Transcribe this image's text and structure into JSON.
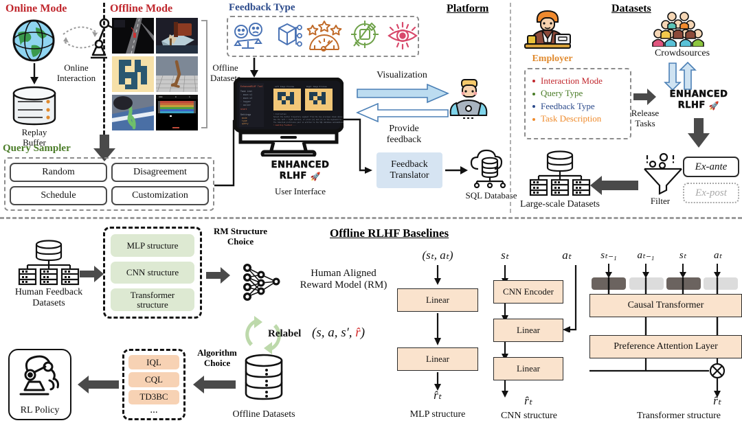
{
  "sections": {
    "online_mode": "Online Mode",
    "offline_mode": "Offline Mode",
    "feedback_type": "Feedback Type",
    "platform": "Platform",
    "datasets": "Datasets",
    "query_sampler": "Query Sampler",
    "offline_rlhf_baselines": "Offline RLHF Baselines"
  },
  "online": {
    "globe_icon": "globe-icon",
    "robot_icon": "robot-arm-icon",
    "interaction_label_line1": "Online",
    "interaction_label_line2": "Interaction",
    "buffer_icon": "database-icon",
    "buffer_label_line1": "Replay",
    "buffer_label_line2": "Buffer"
  },
  "offline": {
    "datasets_label_line1": "Offline",
    "datasets_label_line2": "Datasets",
    "thumbnails": [
      {
        "name": "driving-sim-thumbnail"
      },
      {
        "name": "robot-manipulation-thumbnail"
      },
      {
        "name": "maze-thumbnail"
      },
      {
        "name": "hopper-thumbnail"
      },
      {
        "name": "walker-thumbnail"
      },
      {
        "name": "atari-breakout-thumbnail"
      }
    ]
  },
  "query_sampler": {
    "options": [
      "Random",
      "Disagreement",
      "Schedule",
      "Customization"
    ]
  },
  "feedback_icons": [
    {
      "name": "comparative-feedback-icon",
      "color": "#4a73b5"
    },
    {
      "name": "attribute-feedback-icon",
      "color": "#4a73b5"
    },
    {
      "name": "evaluative-feedback-icon",
      "color": "#c06a28"
    },
    {
      "name": "keypoint-feedback-icon",
      "color": "#6fa24a"
    },
    {
      "name": "visual-feedback-icon",
      "color": "#d8496b"
    }
  ],
  "platform": {
    "ui_logo_line1": "ENHANCED",
    "ui_logo_line2": "RLHF",
    "ui_caption": "User Interface",
    "visualization_label": "Visualization",
    "provide_feedback_line1": "Provide",
    "provide_feedback_line2": "feedback",
    "human_icon": "human-annotator-icon",
    "translator_line1": "Feedback",
    "translator_line2": "Translator",
    "sql_icon": "cloud-database-icon",
    "sql_label": "SQL Database"
  },
  "datasets": {
    "employer_label": "Employer",
    "employer_icon": "employer-icon",
    "employer_items": [
      {
        "label": "Interaction Mode",
        "color": "#c1272d"
      },
      {
        "label": "Query Type",
        "color": "#4a7c27"
      },
      {
        "label": "Feedback Type",
        "color": "#2b4a8b"
      },
      {
        "label": "Task Description",
        "color": "#ef8b2c"
      }
    ],
    "crowdsources_label": "Crowdsources",
    "crowdsources_icon": "crowd-icon",
    "release_tasks_line1": "Release",
    "release_tasks_line2": "Tasks",
    "platform_logo_line1": "ENHANCED",
    "platform_logo_line2": "RLHF",
    "filter_label": "Filter",
    "filter_icon": "funnel-icon",
    "ex_ante": "Ex-ante",
    "ex_post": "Ex-post",
    "large_scale_label": "Large-scale Datasets",
    "large_scale_icon": "server-stack-icon"
  },
  "bottom": {
    "human_feedback_line1": "Human Feedback",
    "human_feedback_line2": "Datasets",
    "human_feedback_icon": "server-stack-icon",
    "rm_structures": [
      "MLP structure",
      "CNN structure",
      "Transformer structure"
    ],
    "rm_structure_choice_line1": "RM Structure",
    "rm_structure_choice_line2": "Choice",
    "nn_icon": "neural-network-icon",
    "reward_model_line1": "Human Aligned",
    "reward_model_line2": "Reward Model (RM)",
    "relabel_label": "Relabel",
    "relabel_tuple_prefix": "(s, a, s′, ",
    "relabel_tuple_r": "r̂",
    "relabel_tuple_suffix": ")",
    "offline_datasets_label": "Offline Datasets",
    "offline_datasets_icon": "database-icon",
    "algorithm_choice_line1": "Algorithm",
    "algorithm_choice_line2": "Choice",
    "algorithms": [
      "IQL",
      "CQL",
      "TD3BC",
      "..."
    ],
    "rl_policy_label": "RL Policy",
    "rl_policy_icon": "robot-arm-icon"
  },
  "mlp": {
    "input": "(sₜ, aₜ)",
    "layers": [
      "Linear",
      "Linear"
    ],
    "output": "r̂ₜ",
    "caption": "MLP structure"
  },
  "cnn": {
    "input_state": "sₜ",
    "input_action": "aₜ",
    "layers": [
      "CNN Encoder",
      "Linear",
      "Linear"
    ],
    "output": "r̂ₜ",
    "caption": "CNN structure"
  },
  "transformer": {
    "tokens": [
      {
        "label": "sₜ₋₁",
        "kind": "state"
      },
      {
        "label": "aₜ₋₁",
        "kind": "action"
      },
      {
        "label": "sₜ",
        "kind": "state"
      },
      {
        "label": "aₜ",
        "kind": "action"
      }
    ],
    "layers": [
      "Causal Transformer",
      "Preference Attention Layer"
    ],
    "sum_symbol": "⊕",
    "output": "r̂ₜ",
    "caption": "Transformer structure"
  },
  "colors": {
    "green_box": "#dde9d2",
    "peach_box": "#f7d2b4",
    "linear_box": "#fae3cd",
    "blue_box": "#d6e4f2",
    "state_token": "#6b635f",
    "action_token": "#dcdcdc",
    "arrow_gray": "#4a4a4a"
  }
}
